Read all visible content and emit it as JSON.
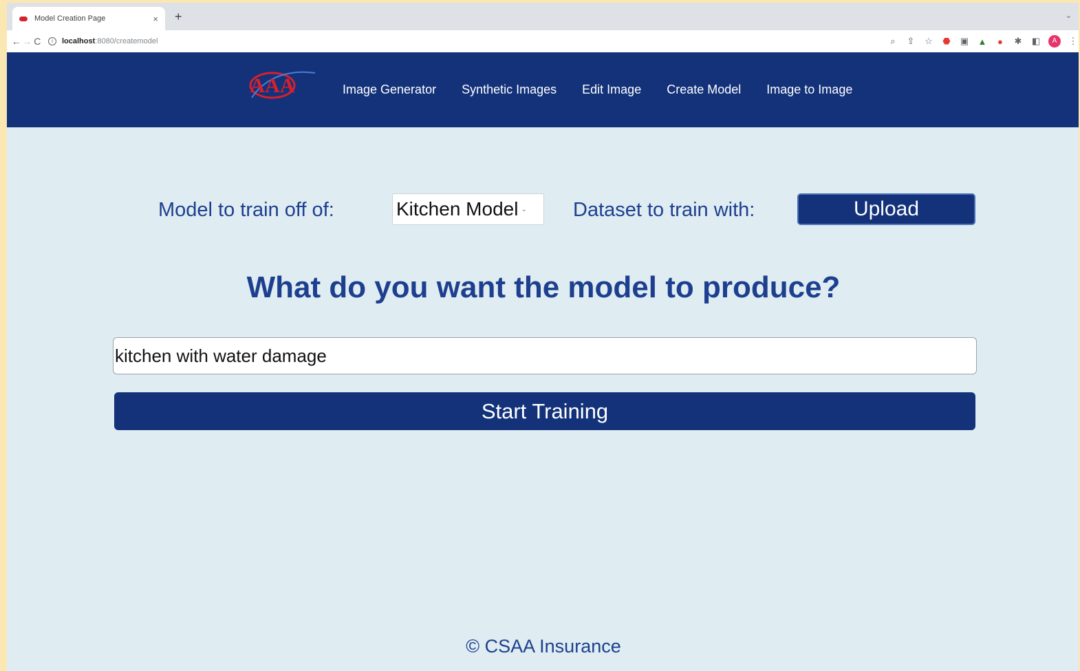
{
  "browser": {
    "tab_title": "Model Creation Page",
    "tab_close": "×",
    "new_tab": "+",
    "tab_menu": "⌄",
    "back": "←",
    "forward": "→",
    "reload": "C",
    "url_host": "localhost",
    "url_path": ":8080/createmodel",
    "menu": "⋮",
    "avatar_letter": "A"
  },
  "header": {
    "logo_text": "AAA",
    "nav": [
      {
        "label": "Image Generator"
      },
      {
        "label": "Synthetic Images"
      },
      {
        "label": "Edit Image"
      },
      {
        "label": "Create Model"
      },
      {
        "label": "Image to Image"
      }
    ]
  },
  "form": {
    "model_label": "Model to train off of:",
    "model_selected": "Kitchen Model",
    "dataset_label": "Dataset to train with:",
    "upload_label": "Upload",
    "question": "What do you want the model to produce?",
    "prompt_value": "kitchen with water damage",
    "start_label": "Start Training"
  },
  "footer": {
    "text": "© CSAA Insurance"
  },
  "colors": {
    "navy": "#13327a",
    "text_blue": "#1d3f8f",
    "page_bg": "#dfecf1",
    "logo_red": "#d6202e"
  }
}
